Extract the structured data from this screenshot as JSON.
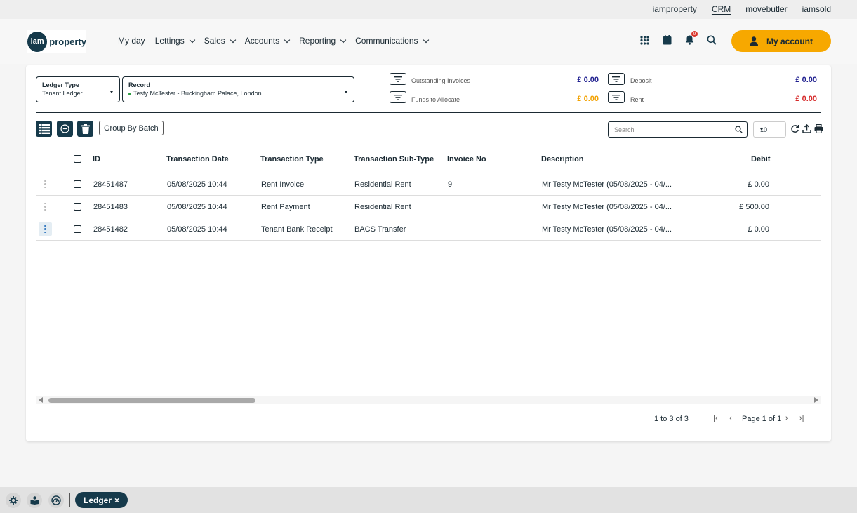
{
  "top_links": [
    "iamproperty",
    "CRM",
    "movebutler",
    "iamsold"
  ],
  "top_links_active": "CRM",
  "logo": {
    "circle": "iam",
    "text": "property"
  },
  "menu": [
    {
      "label": "My day",
      "dropdown": false
    },
    {
      "label": "Lettings",
      "dropdown": true
    },
    {
      "label": "Sales",
      "dropdown": true
    },
    {
      "label": "Accounts",
      "dropdown": true,
      "active": true
    },
    {
      "label": "Reporting",
      "dropdown": true
    },
    {
      "label": "Communications",
      "dropdown": true
    }
  ],
  "nav_icons": [
    "apps-grid-icon",
    "calendar-icon",
    "bell-icon",
    "search-icon"
  ],
  "notification_count": "9",
  "account_button": "My account",
  "filters": {
    "ledger_type_label": "Ledger Type",
    "ledger_type_value": "Tenant Ledger",
    "record_label": "Record",
    "record_value": "Testy McTester - Buckingham Palace, London"
  },
  "summary": {
    "outstanding_invoices": {
      "label": "Outstanding Invoices",
      "value": "£ 0.00",
      "color": "#1f1f8f"
    },
    "funds_to_allocate": {
      "label": "Funds to Allocate",
      "value": "£ 0.00",
      "color": "#f2a100"
    },
    "deposit": {
      "label": "Deposit",
      "value": "£ 0.00",
      "color": "#1f1f8f"
    },
    "rent": {
      "label": "Rent",
      "value": "£ 0.00",
      "color": "#d62b2b"
    }
  },
  "toolbar": {
    "group_by_batch": "Group By Batch",
    "search_placeholder": "Search",
    "page_size": "10"
  },
  "table": {
    "columns": [
      "ID",
      "Transaction Date",
      "Transaction Type",
      "Transaction Sub-Type",
      "Invoice No",
      "Description",
      "Debit"
    ],
    "rows": [
      {
        "id": "28451487",
        "date": "05/08/2025 10:44",
        "type": "Rent Invoice",
        "subtype": "Residential Rent",
        "invoice": "9",
        "description": "Mr Testy McTester (05/08/2025 - 04/...",
        "debit": "£ 0.00"
      },
      {
        "id": "28451483",
        "date": "05/08/2025 10:44",
        "type": "Rent Payment",
        "subtype": "Residential Rent",
        "invoice": "",
        "description": "Mr Testy McTester (05/08/2025 - 04/...",
        "debit": "£ 500.00"
      },
      {
        "id": "28451482",
        "date": "05/08/2025 10:44",
        "type": "Tenant Bank Receipt",
        "subtype": "BACS Transfer",
        "invoice": "",
        "description": "Mr Testy McTester (05/08/2025 - 04/...",
        "debit": "£ 0.00"
      }
    ]
  },
  "pagination": {
    "range": "1 to 3 of 3",
    "page": "Page 1 of 1",
    "first": "|‹",
    "prev": "‹",
    "next": "›",
    "last": "›|"
  },
  "bottom_tab": "Ledger",
  "bottom_tab_close": "×",
  "colors": {
    "brand_dark": "#163a4b",
    "accent": "#f7a800"
  }
}
